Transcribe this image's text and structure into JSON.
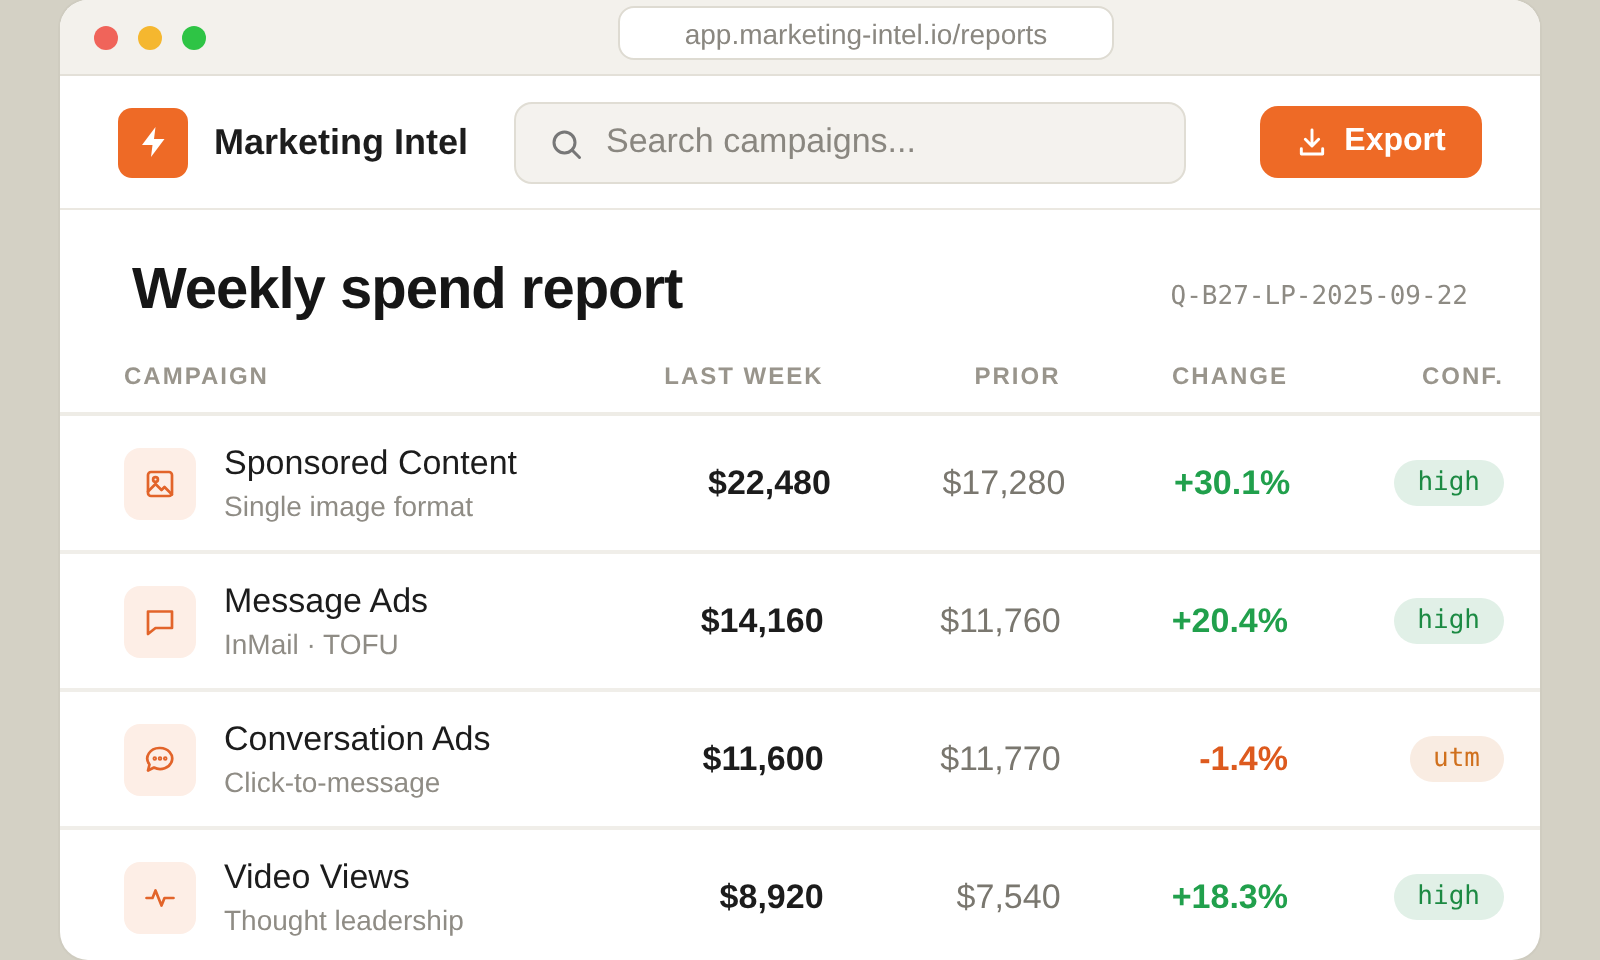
{
  "browser": {
    "url": "app.marketing-intel.io/reports"
  },
  "header": {
    "brand": "Marketing Intel",
    "search": {
      "placeholder": "Search campaigns..."
    },
    "export_button": "Export"
  },
  "report": {
    "title": "Weekly spend report",
    "reference": "Q-B27-LP-2025-09-22"
  },
  "table": {
    "columns": [
      "CAMPAIGN",
      "LAST WEEK",
      "PRIOR",
      "CHANGE",
      "CONF."
    ],
    "rows": [
      {
        "kind": "image",
        "name": "Sponsored Content",
        "subtitle": "Single image format",
        "last_week": "$22,480",
        "prior": "$17,280",
        "change": {
          "text": "+30.1%",
          "color": "#21a04c"
        },
        "confidence": {
          "text": "high",
          "color": "#1c8a43"
        }
      },
      {
        "kind": "message",
        "name": "Message Ads",
        "subtitle": "InMail · TOFU",
        "last_week": "$14,160",
        "prior": "$11,760",
        "change": {
          "text": "+20.4%",
          "color": "#21a04c"
        },
        "confidence": {
          "text": "high",
          "color": "#1c8a43"
        }
      },
      {
        "kind": "chat",
        "name": "Conversation Ads",
        "subtitle": "Click-to-message",
        "last_week": "$11,600",
        "prior": "$11,770",
        "change": {
          "text": "-1.4%",
          "color": "#dd5a1e"
        },
        "confidence": {
          "text": "utm",
          "color": "#d0701d"
        }
      },
      {
        "kind": "pulse",
        "name": "Video Views",
        "subtitle": "Thought leadership",
        "last_week": "$8,920",
        "prior": "$7,540",
        "change": {
          "text": "+18.3%",
          "color": "#21a04c"
        },
        "confidence": {
          "text": "high",
          "color": "#1c8a43"
        }
      }
    ]
  }
}
